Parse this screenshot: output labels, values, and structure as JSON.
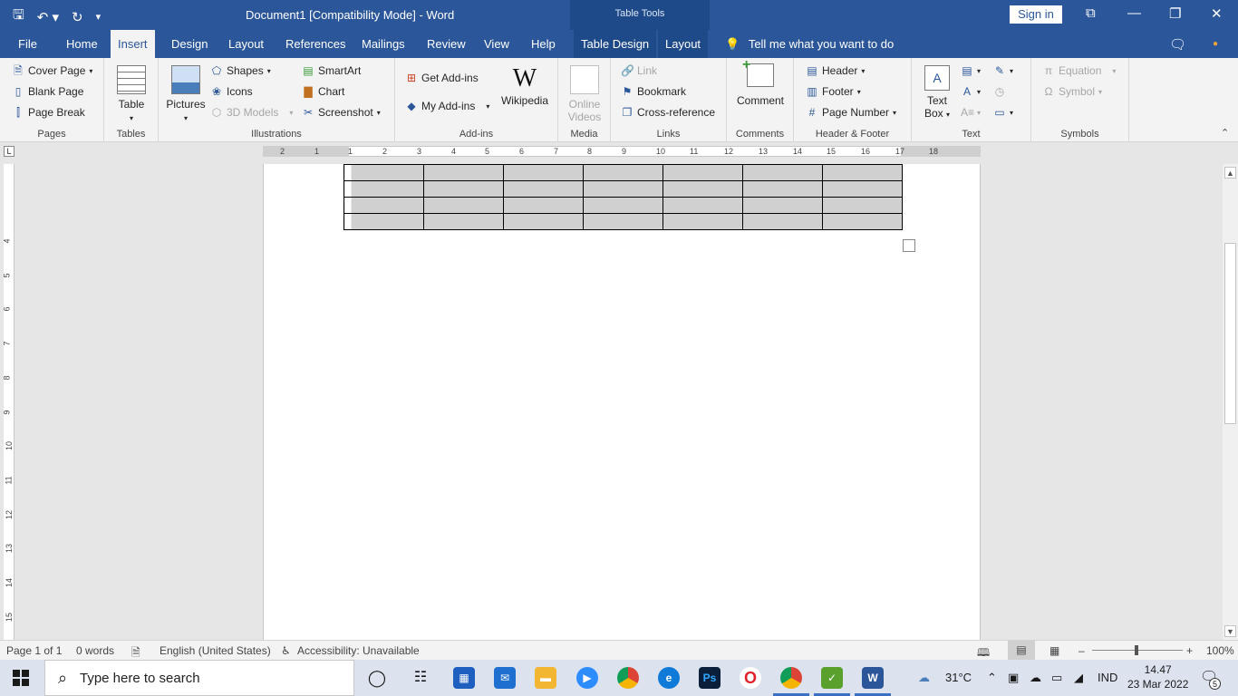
{
  "window": {
    "title": "Document1 [Compatibility Mode]  -  Word",
    "context_label": "Table Tools",
    "sign_in": "Sign in"
  },
  "tabs": [
    "File",
    "Home",
    "Insert",
    "Design",
    "Layout",
    "References",
    "Mailings",
    "Review",
    "View",
    "Help",
    "Table Design",
    "Layout"
  ],
  "active_tab": "Insert",
  "tell_me": "Tell me what you want to do",
  "ribbon": {
    "pages": {
      "label": "Pages",
      "cover_page": "Cover Page",
      "blank_page": "Blank Page",
      "page_break": "Page Break"
    },
    "tables": {
      "label": "Tables",
      "table": "Table"
    },
    "illustrations": {
      "label": "Illustrations",
      "pictures": "Pictures",
      "shapes": "Shapes",
      "icons": "Icons",
      "models_3d": "3D Models",
      "smartart": "SmartArt",
      "chart": "Chart",
      "screenshot": "Screenshot"
    },
    "addins": {
      "label": "Add-ins",
      "get_addins": "Get Add-ins",
      "my_addins": "My Add-ins",
      "wikipedia": "Wikipedia"
    },
    "media": {
      "label": "Media",
      "online_videos_1": "Online",
      "online_videos_2": "Videos"
    },
    "links": {
      "label": "Links",
      "link": "Link",
      "bookmark": "Bookmark",
      "cross_reference": "Cross-reference"
    },
    "comments": {
      "label": "Comments",
      "comment": "Comment"
    },
    "header_footer": {
      "label": "Header & Footer",
      "header": "Header",
      "footer": "Footer",
      "page_number": "Page Number"
    },
    "text": {
      "label": "Text",
      "text_box_1": "Text",
      "text_box_2": "Box"
    },
    "symbols": {
      "label": "Symbols",
      "equation": "Equation",
      "symbol": "Symbol"
    }
  },
  "ruler": {
    "numbers": [
      "2",
      "1",
      "1",
      "2",
      "3",
      "4",
      "5",
      "6",
      "7",
      "8",
      "9",
      "10",
      "11",
      "12",
      "13",
      "14",
      "15",
      "16",
      "17",
      "18"
    ]
  },
  "vruler": {
    "numbers": [
      "4",
      "5",
      "6",
      "7",
      "8",
      "9",
      "10",
      "11",
      "12",
      "13",
      "14",
      "15"
    ]
  },
  "table": {
    "rows": 4,
    "cols": 7
  },
  "status": {
    "page": "Page 1 of 1",
    "words": "0 words",
    "language": "English (United States)",
    "accessibility": "Accessibility: Unavailable",
    "zoom": "100%"
  },
  "taskbar": {
    "search_placeholder": "Type here to search",
    "weather": "31°C",
    "lang": "IND",
    "time": "14.47",
    "date": "23 Mar 2022",
    "notifications": "5"
  },
  "colors": {
    "brand": "#2b579a",
    "ribbon_bg": "#f3f3f3",
    "table_shade": "#d0d0d0"
  }
}
